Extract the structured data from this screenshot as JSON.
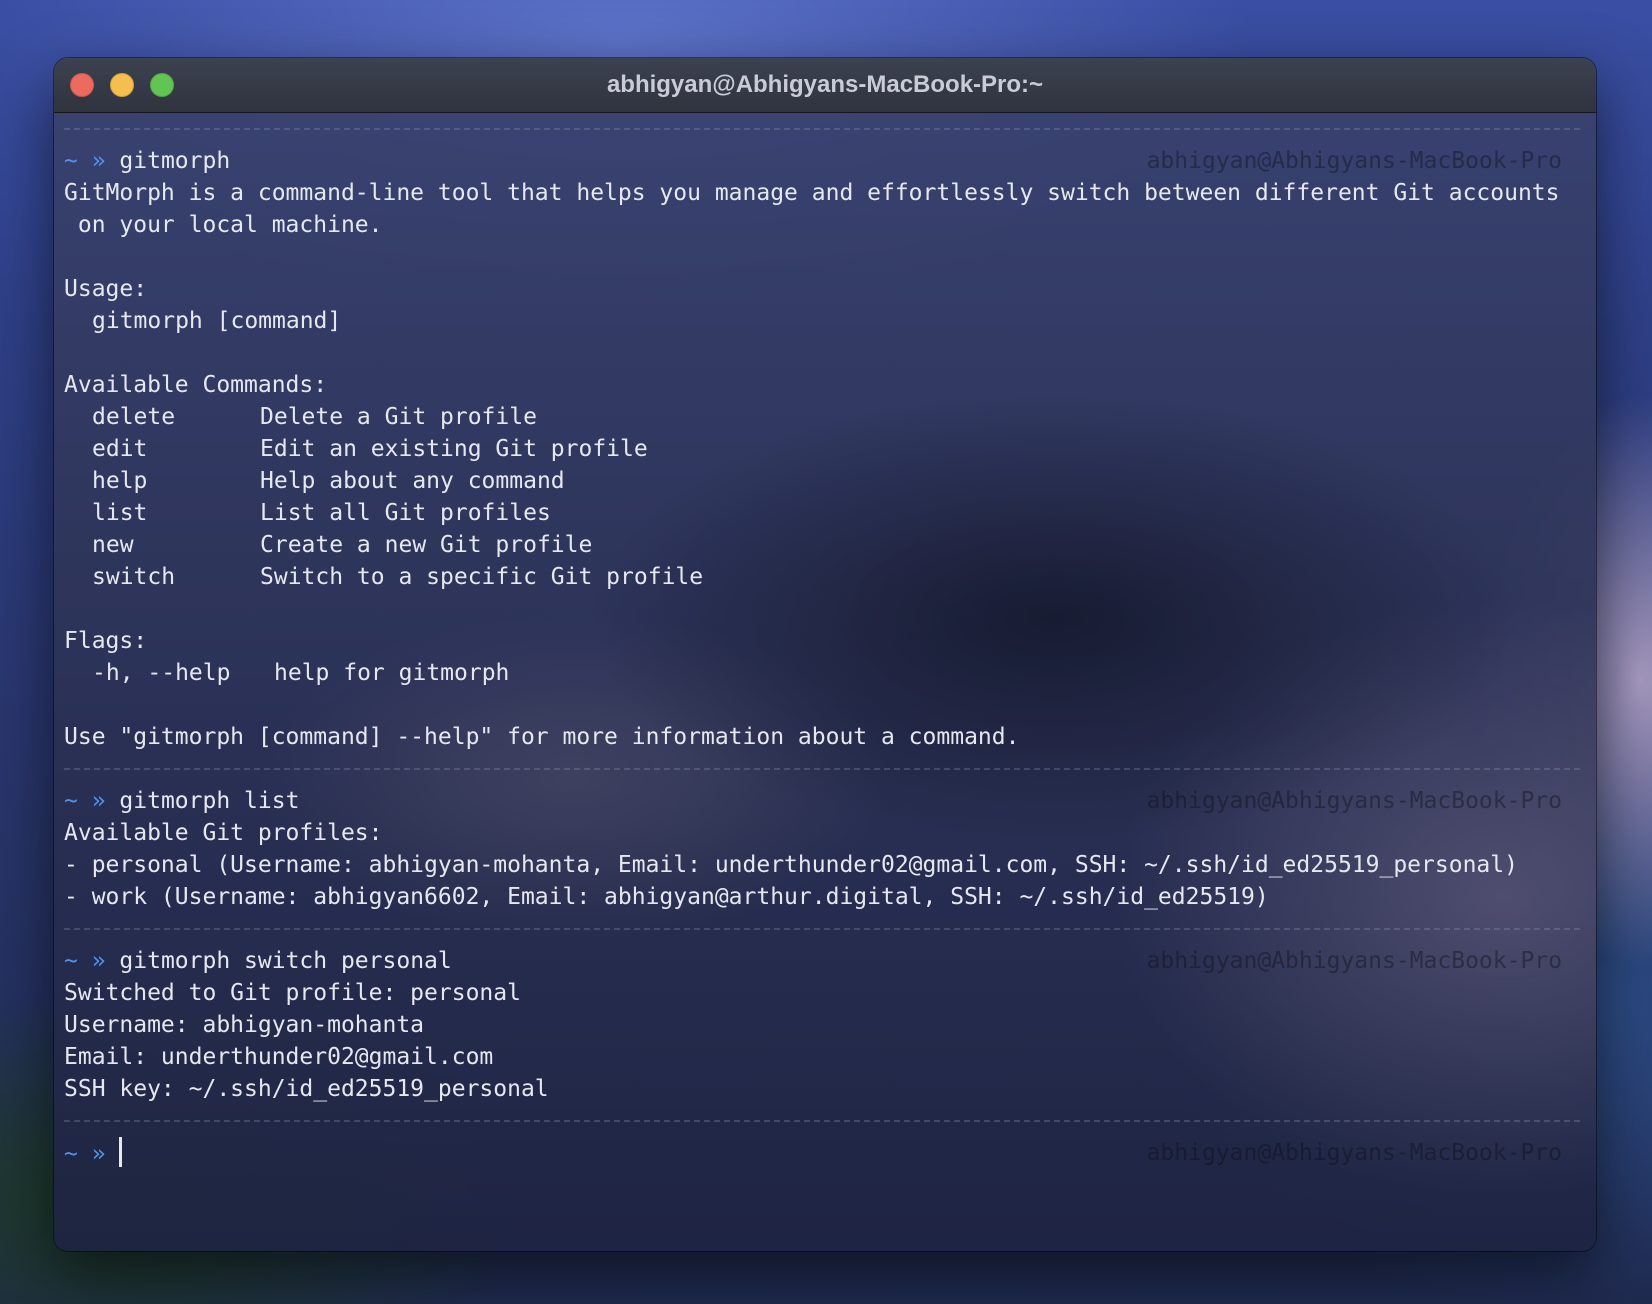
{
  "window": {
    "title": "abhigyan@Abhigyans-MacBook-Pro:~"
  },
  "prompt": {
    "symbol": "~ »",
    "host": "abhigyan@Abhigyans-MacBook-Pro"
  },
  "block1": {
    "command": "gitmorph",
    "description": [
      "GitMorph is a command-line tool that helps you manage and effortlessly switch between different Git accounts",
      " on your local machine."
    ],
    "usage_label": "Usage:",
    "usage_value": "gitmorph [command]",
    "commands_label": "Available Commands:",
    "commands": [
      {
        "name": "delete",
        "desc": "Delete a Git profile"
      },
      {
        "name": "edit",
        "desc": "Edit an existing Git profile"
      },
      {
        "name": "help",
        "desc": "Help about any command"
      },
      {
        "name": "list",
        "desc": "List all Git profiles"
      },
      {
        "name": "new",
        "desc": "Create a new Git profile"
      },
      {
        "name": "switch",
        "desc": "Switch to a specific Git profile"
      }
    ],
    "flags_label": "Flags:",
    "flag": {
      "name": "-h, --help",
      "desc": "help for gitmorph"
    },
    "footer": "Use \"gitmorph [command] --help\" for more information about a command."
  },
  "block2": {
    "command": "gitmorph list",
    "lines": [
      "Available Git profiles:",
      "- personal (Username: abhigyan-mohanta, Email: underthunder02@gmail.com, SSH: ~/.ssh/id_ed25519_personal)",
      "- work (Username: abhigyan6602, Email: abhigyan@arthur.digital, SSH: ~/.ssh/id_ed25519)"
    ]
  },
  "block3": {
    "command": "gitmorph switch personal",
    "lines": [
      "Switched to Git profile: personal",
      "Username: abhigyan-mohanta",
      "Email: underthunder02@gmail.com",
      "SSH key: ~/.ssh/id_ed25519_personal"
    ]
  },
  "block4": {
    "command": ""
  }
}
